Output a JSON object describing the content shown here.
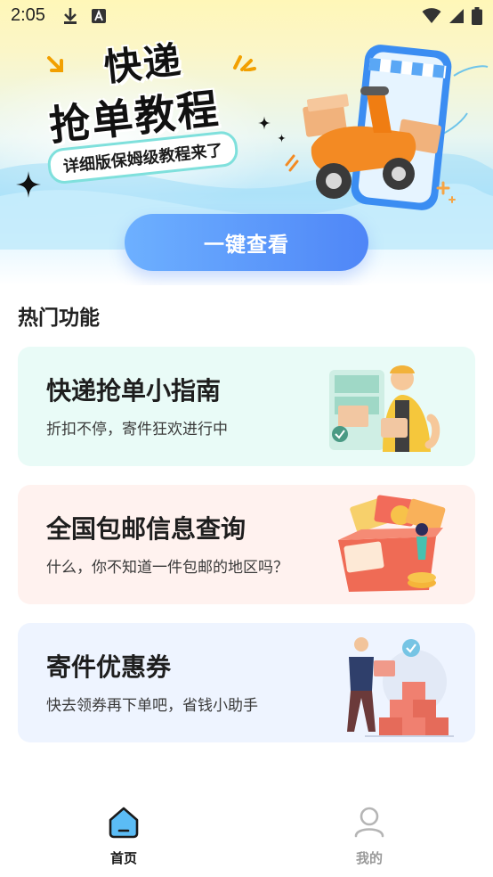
{
  "status_bar": {
    "time": "2:05",
    "left_icons": [
      "download-icon",
      "a-font-icon"
    ],
    "right_icons": [
      "wifi-icon",
      "signal-icon",
      "battery-icon"
    ]
  },
  "hero": {
    "title_line1": "快递",
    "title_line2": "抢单教程",
    "tagline": "详细版保姆级教程来了",
    "cta_label": "一键查看",
    "illustration": "scooter-delivery-phone-illustration"
  },
  "section": {
    "title": "热门功能"
  },
  "cards": [
    {
      "title": "快递抢单小指南",
      "subtitle": "折扣不停，寄件狂欢进行中",
      "icon": "courier-illustration",
      "bg": "#e9fbf7"
    },
    {
      "title": "全国包邮信息查询",
      "subtitle": "什么，你不知道一件包邮的地区吗？",
      "icon": "gift-box-illustration",
      "bg": "#fff2ef"
    },
    {
      "title": "寄件优惠券",
      "subtitle": "快去领券再下单吧，省钱小助手",
      "icon": "package-worker-illustration",
      "bg": "#eef4ff"
    }
  ],
  "bottom_nav": {
    "items": [
      {
        "label": "首页",
        "icon": "home-icon",
        "active": true
      },
      {
        "label": "我的",
        "icon": "user-icon",
        "active": false
      }
    ],
    "active_color": "#1a1a1a",
    "inactive_color": "#9a9a9a"
  },
  "colors": {
    "accent": "#4f86f7",
    "cta_start": "#6db0ff"
  }
}
